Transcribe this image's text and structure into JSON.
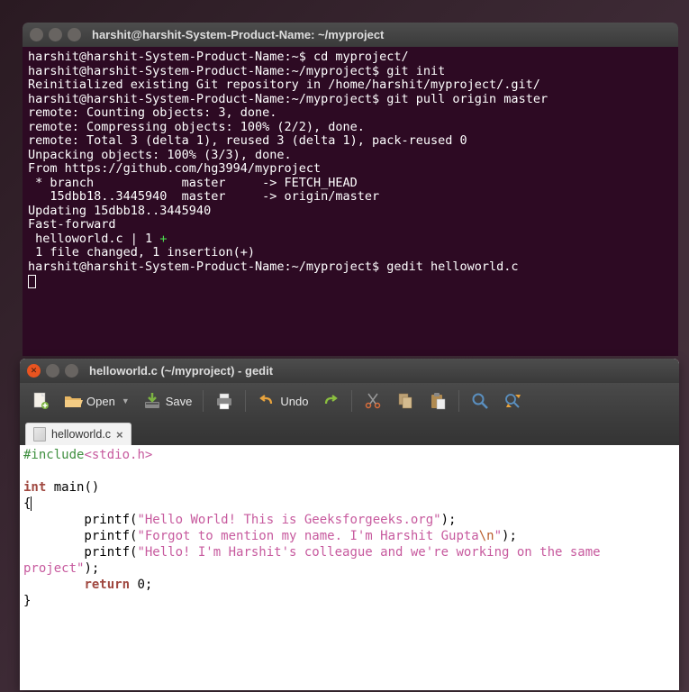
{
  "terminal": {
    "title": "harshit@harshit-System-Product-Name: ~/myproject",
    "prompt1": "harshit@harshit-System-Product-Name:~$ ",
    "cmd1": "cd myproject/",
    "prompt2": "harshit@harshit-System-Product-Name:~/myproject$ ",
    "cmd2": "git init",
    "out1": "Reinitialized existing Git repository in /home/harshit/myproject/.git/",
    "cmd3": "git pull origin master",
    "out2": "remote: Counting objects: 3, done.",
    "out3": "remote: Compressing objects: 100% (2/2), done.",
    "out4": "remote: Total 3 (delta 1), reused 3 (delta 1), pack-reused 0",
    "out5": "Unpacking objects: 100% (3/3), done.",
    "out6": "From https://github.com/hg3994/myproject",
    "out7": " * branch            master     -> FETCH_HEAD",
    "out8": "   15dbb18..3445940  master     -> origin/master",
    "out9": "Updating 15dbb18..3445940",
    "out10": "Fast-forward",
    "out11_a": " helloworld.c | 1 ",
    "out11_b": "+",
    "out12": " 1 file changed, 1 insertion(+)",
    "cmd4": "gedit helloworld.c"
  },
  "gedit": {
    "title": "helloworld.c (~/myproject) - gedit",
    "toolbar": {
      "open": "Open",
      "save": "Save",
      "undo": "Undo"
    },
    "tab": {
      "filename": "helloworld.c"
    },
    "code": {
      "l1_inc": "#include",
      "l1_lib": "<stdio.h>",
      "l2_kw": "int",
      "l2_rest": " main()",
      "l3": "{",
      "l4_pre": "        printf(",
      "l4_str": "\"Hello World! This is Geeksforgeeks.org\"",
      "l4_post": ");",
      "l5_pre": "        printf(",
      "l5_str_a": "\"Forgot to mention my name. I'm Harshit Gupta",
      "l5_esc": "\\n",
      "l5_str_b": "\"",
      "l5_post": ");",
      "l6_pre": "        printf(",
      "l6_str": "\"Hello! I'm Harshit's colleague and we're working on the same ",
      "l7_str": "project\"",
      "l7_post": ");",
      "l8_pre": "        ",
      "l8_kw": "return",
      "l8_post": " 0;",
      "l9": "}"
    }
  }
}
